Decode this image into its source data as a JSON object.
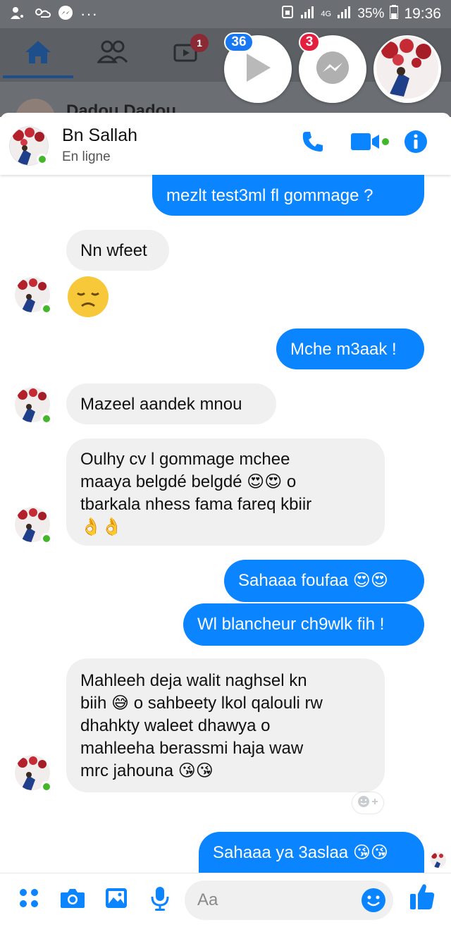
{
  "status_bar": {
    "battery": "35%",
    "time": "19:36",
    "network": "4G"
  },
  "fb_nav": {
    "watch_badge": "1",
    "story_name": "Dadou Dadou"
  },
  "chat_heads": {
    "video_badge": "36",
    "messenger_badge": "3"
  },
  "chat": {
    "name": "Bn Sallah",
    "status": "En ligne"
  },
  "messages": [
    {
      "side": "out",
      "text": "mezlt test3ml fl gommage  ?"
    },
    {
      "side": "in",
      "text": "Nn wfeet"
    },
    {
      "side": "out",
      "text": "Mche m3aak !"
    },
    {
      "side": "in",
      "text": "Mazeel aandek mnou"
    },
    {
      "side": "in",
      "text": "Oulhy cv l gommage mchee\nmaaya belgdé belgdé 😍😍 o\ntbarkala nhess fama fareq  kbiir\n👌👌"
    },
    {
      "side": "out",
      "text": "Sahaaa foufaa 😍😍"
    },
    {
      "side": "out",
      "text": "Wl blancheur ch9wlk fih !"
    },
    {
      "side": "in",
      "text": "Mahleeh deja walit naghsel kn\nbiih 😅 o sahbeety lkol qalouli rw\ndhahkty waleet dhawya o\nmahleeha berassmi haja waw\nmrc jahouna 😘😘"
    },
    {
      "side": "out",
      "text": "Sahaaa ya 3aslaa 😘😘"
    }
  ],
  "composer": {
    "placeholder": "Aa"
  },
  "colors": {
    "accent": "#0a84ff",
    "online": "#42b72a",
    "incoming_bubble": "#f0f0f0",
    "badge_red": "#e41e3f"
  }
}
